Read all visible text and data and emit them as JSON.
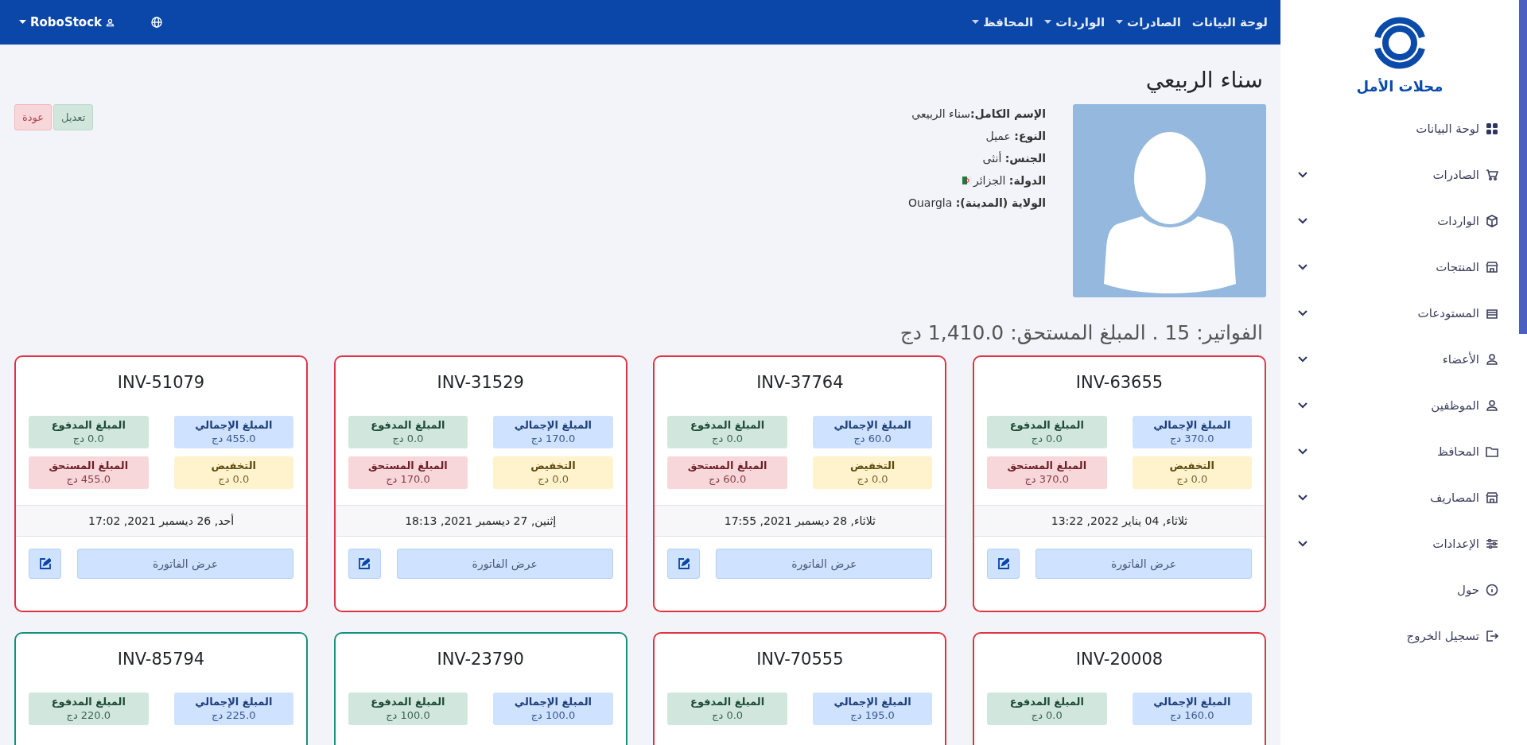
{
  "topbar": {
    "nav": [
      {
        "label": "لوحة البيانات",
        "dropdown": false
      },
      {
        "label": "الصادرات",
        "dropdown": true
      },
      {
        "label": "الواردات",
        "dropdown": true
      },
      {
        "label": "المحافظ",
        "dropdown": true
      }
    ],
    "user": "RoboStock"
  },
  "sidebar": {
    "brand": "محلات الأمل",
    "items": [
      {
        "label": "لوحة البيانات",
        "kind": "link"
      },
      {
        "label": "الصادرات",
        "kind": "group"
      },
      {
        "label": "الواردات",
        "kind": "group"
      },
      {
        "label": "المنتجات",
        "kind": "group"
      },
      {
        "label": "المستودعات",
        "kind": "group"
      },
      {
        "label": "الأعضاء",
        "kind": "group"
      },
      {
        "label": "الموظفين",
        "kind": "group"
      },
      {
        "label": "المحافظ",
        "kind": "group"
      },
      {
        "label": "المصاريف",
        "kind": "group"
      },
      {
        "label": "الإعدادات",
        "kind": "group"
      },
      {
        "label": "حول",
        "kind": "link"
      },
      {
        "label": "تسجيل الخروج",
        "kind": "link"
      }
    ]
  },
  "profile": {
    "name": "سناء الربيعي",
    "fields": [
      {
        "label": "الإسم الكامل:",
        "value": "سناء الربيعي",
        "flag": false
      },
      {
        "label": "النوع:",
        "value": " عميل",
        "flag": false
      },
      {
        "label": "الجنس:",
        "value": " أنثى",
        "flag": false
      },
      {
        "label": "الدولة:",
        "value": " الجزائر",
        "flag": true
      },
      {
        "label": "الولاية (المدينة):",
        "value": " Ouargla",
        "flag": false
      }
    ],
    "buttons": [
      {
        "label": "تعديل",
        "kind": "edit"
      },
      {
        "label": "عودة",
        "kind": "back"
      }
    ]
  },
  "invoices_heading": "الفواتير: 15 . المبلغ المستحق: 1,410.0 دج",
  "invoices": [
    {
      "id": "INV-63655",
      "color": "#dc3545",
      "stats": [
        {
          "kind": "total",
          "label": "المبلغ الإجمالي",
          "value": "370.0 دج"
        },
        {
          "kind": "paid",
          "label": "المبلغ المدفوع",
          "value": "0.0 دج"
        },
        {
          "kind": "discount",
          "label": "التخفيض",
          "value": "0.0 دج"
        },
        {
          "kind": "due",
          "label": "المبلغ المستحق",
          "value": "370.0 دج"
        }
      ],
      "date": "ثلاثاء, 04 يناير 2022, 13:22",
      "view_label": "عرض الفاتورة"
    },
    {
      "id": "INV-37764",
      "color": "#dc3545",
      "stats": [
        {
          "kind": "total",
          "label": "المبلغ الإجمالي",
          "value": "60.0 دج"
        },
        {
          "kind": "paid",
          "label": "المبلغ المدفوع",
          "value": "0.0 دج"
        },
        {
          "kind": "discount",
          "label": "التخفيض",
          "value": "0.0 دج"
        },
        {
          "kind": "due",
          "label": "المبلغ المستحق",
          "value": "60.0 دج"
        }
      ],
      "date": "ثلاثاء, 28 ديسمبر 2021, 17:55",
      "view_label": "عرض الفاتورة"
    },
    {
      "id": "INV-31529",
      "color": "#dc3545",
      "stats": [
        {
          "kind": "total",
          "label": "المبلغ الإجمالي",
          "value": "170.0 دج"
        },
        {
          "kind": "paid",
          "label": "المبلغ المدفوع",
          "value": "0.0 دج"
        },
        {
          "kind": "discount",
          "label": "التخفيض",
          "value": "0.0 دج"
        },
        {
          "kind": "due",
          "label": "المبلغ المستحق",
          "value": "170.0 دج"
        }
      ],
      "date": "إثنين, 27 ديسمبر 2021, 18:13",
      "view_label": "عرض الفاتورة"
    },
    {
      "id": "INV-51079",
      "color": "#dc3545",
      "stats": [
        {
          "kind": "total",
          "label": "المبلغ الإجمالي",
          "value": "455.0 دج"
        },
        {
          "kind": "paid",
          "label": "المبلغ المدفوع",
          "value": "0.0 دج"
        },
        {
          "kind": "discount",
          "label": "التخفيض",
          "value": "0.0 دج"
        },
        {
          "kind": "due",
          "label": "المبلغ المستحق",
          "value": "455.0 دج"
        }
      ],
      "date": "أحد, 26 ديسمبر 2021, 17:02",
      "view_label": "عرض الفاتورة"
    },
    {
      "id": "INV-20008",
      "color": "#dc3545",
      "stats": [
        {
          "kind": "total",
          "label": "المبلغ الإجمالي",
          "value": "160.0 دج"
        },
        {
          "kind": "paid",
          "label": "المبلغ المدفوع",
          "value": "0.0 دج"
        }
      ]
    },
    {
      "id": "INV-70555",
      "color": "#dc3545",
      "stats": [
        {
          "kind": "total",
          "label": "المبلغ الإجمالي",
          "value": "195.0 دج"
        },
        {
          "kind": "paid",
          "label": "المبلغ المدفوع",
          "value": "0.0 دج"
        }
      ]
    },
    {
      "id": "INV-23790",
      "color": "#198f7d",
      "stats": [
        {
          "kind": "total",
          "label": "المبلغ الإجمالي",
          "value": "100.0 دج"
        },
        {
          "kind": "paid",
          "label": "المبلغ المدفوع",
          "value": "100.0 دج"
        }
      ]
    },
    {
      "id": "INV-85794",
      "color": "#198f7d",
      "stats": [
        {
          "kind": "total",
          "label": "المبلغ الإجمالي",
          "value": "225.0 دج"
        },
        {
          "kind": "paid",
          "label": "المبلغ المدفوع",
          "value": "220.0 دج"
        }
      ]
    }
  ]
}
